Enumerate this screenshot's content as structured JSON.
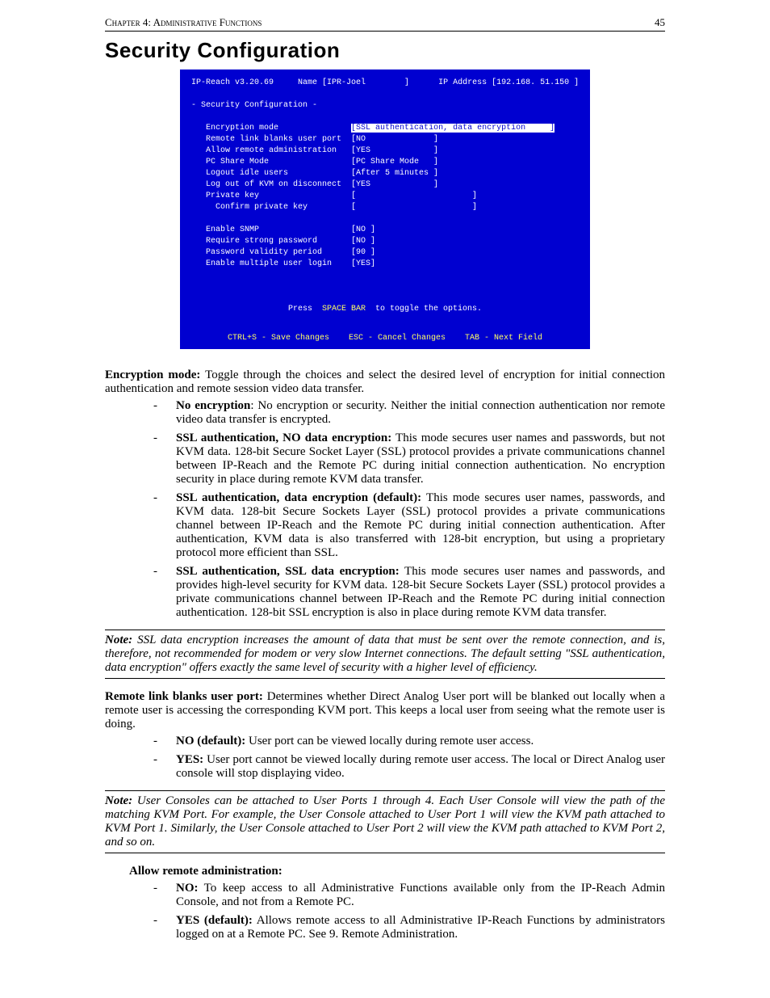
{
  "header": {
    "chapter": "Chapter 4: Administrative Functions",
    "page_number": "45"
  },
  "section_title": "Security Configuration",
  "terminal": {
    "top_left": "IP-Reach v3.20.69",
    "name_label": "Name",
    "name_value": "IPR-Joel",
    "ip_label": "IP Address",
    "ip_value": "192.168. 51.150",
    "menu_title": "- Security Configuration -",
    "fields": [
      {
        "label": "Encryption mode",
        "value": "SSL authentication, data encryption",
        "highlight": true
      },
      {
        "label": "Remote link blanks user port",
        "value": "NO"
      },
      {
        "label": "Allow remote administration",
        "value": "YES"
      },
      {
        "label": "PC Share Mode",
        "value": "PC Share Mode"
      },
      {
        "label": "Logout idle users",
        "value": "After 5 minutes"
      },
      {
        "label": "Log out of KVM on disconnect",
        "value": "YES"
      },
      {
        "label": "Private key",
        "value": ""
      },
      {
        "label": "  Confirm private key",
        "value": ""
      }
    ],
    "fields2": [
      {
        "label": "Enable SNMP",
        "value": "NO"
      },
      {
        "label": "Require strong password",
        "value": "NO"
      },
      {
        "label": "Password validity period",
        "value": "90"
      },
      {
        "label": "Enable multiple user login",
        "value": "YES"
      }
    ],
    "hint_prefix": "Press  ",
    "hint_key": "SPACE BAR",
    "hint_suffix": "  to toggle the options.",
    "footer": "CTRL+S - Save Changes    ESC - Cancel Changes    TAB - Next Field"
  },
  "encryption_mode": {
    "lead_label": "Encryption mode:",
    "lead_text": " Toggle through the choices and select the desired level of encryption for initial connection authentication and remote session video data transfer.",
    "items": [
      {
        "label": "No encryption",
        "text": ": No encryption or security. Neither the initial connection authentication nor remote video data transfer is encrypted."
      },
      {
        "label": "SSL authentication, NO data encryption:",
        "text": " This mode secures user names and passwords, but not KVM data. 128-bit Secure Socket Layer (SSL) protocol provides a private communications channel between IP-Reach and the Remote PC during initial connection authentication. No encryption security in place during remote KVM data transfer."
      },
      {
        "label": "SSL authentication, data encryption (default):",
        "text": " This mode secures user names, passwords, and KVM data. 128-bit Secure Sockets Layer (SSL) protocol provides a private communications channel between IP-Reach and the Remote PC during initial connection authentication. After authentication, KVM data is also transferred with 128-bit encryption, but using a proprietary protocol more efficient than SSL."
      },
      {
        "label": "SSL authentication, SSL data encryption:",
        "text": " This mode secures user names and passwords, and provides high-level security for KVM data. 128-bit Secure Sockets Layer (SSL) protocol provides a private communications channel between IP-Reach and the Remote PC during initial connection authentication. 128-bit SSL encryption is also in place during remote KVM data transfer."
      }
    ]
  },
  "note1": {
    "label": "Note:",
    "text": " SSL data encryption increases the amount of data that must be sent over the remote connection, and is, therefore, not recommended for modem or very slow Internet connections. The default setting \"SSL authentication, data encryption\" offers exactly the same level of security with a higher level of efficiency."
  },
  "remote_link": {
    "lead_label": "Remote link blanks user port:",
    "lead_text": " Determines whether Direct Analog User port will be blanked out locally when a remote user is accessing the corresponding KVM port. This keeps a local user from seeing what the remote user is doing.",
    "items": [
      {
        "label": "NO (default):",
        "text": " User port can be viewed locally during remote user access."
      },
      {
        "label": "YES:",
        "text": " User port cannot be viewed locally during remote user access. The local or Direct Analog user console will stop displaying video."
      }
    ]
  },
  "note2": {
    "label": "Note:",
    "text": " User Consoles can be attached to User Ports 1 through 4. Each User Console will view the path of the matching KVM Port. For example, the User Console attached to User Port 1 will view the KVM path attached to KVM Port 1. Similarly, the User Console attached to User Port 2 will view the KVM path attached to KVM Port 2, and so on."
  },
  "allow_remote": {
    "lead_label": "Allow remote administration:",
    "items": [
      {
        "label": "NO:",
        "text": " To keep access to all Administrative Functions available only from the IP-Reach Admin Console, and not from a Remote PC."
      },
      {
        "label": "YES (default):",
        "text": " Allows remote access to all Administrative IP-Reach Functions by administrators logged on at a Remote PC. See 9. Remote Administration."
      }
    ]
  }
}
